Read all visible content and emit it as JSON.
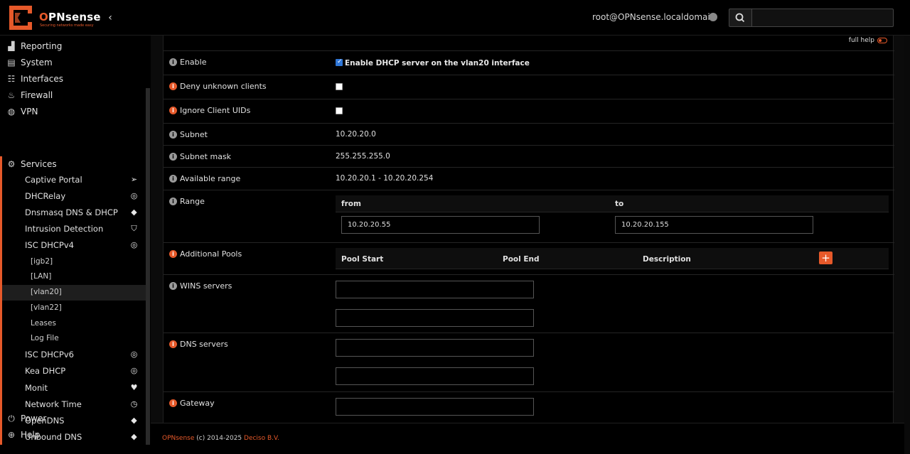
{
  "header": {
    "brand_prefix": "O",
    "brand_rest": "PNsense",
    "tagline": "Securing networks made easy",
    "user": "root@OPNsense.localdomain",
    "search_placeholder": ""
  },
  "sidebar": {
    "top": [
      {
        "label": "Reporting",
        "icon": "chart-icon"
      },
      {
        "label": "System",
        "icon": "server-icon"
      },
      {
        "label": "Interfaces",
        "icon": "sitemap-icon"
      },
      {
        "label": "Firewall",
        "icon": "fire-icon"
      },
      {
        "label": "VPN",
        "icon": "globe-icon"
      },
      {
        "label": "Services",
        "icon": "cog-icon"
      }
    ],
    "services": [
      {
        "label": "Captive Portal",
        "icon": "paper-plane-icon"
      },
      {
        "label": "DHCRelay",
        "icon": "bullseye-icon"
      },
      {
        "label": "Dnsmasq DNS & DHCP",
        "icon": "tags-icon"
      },
      {
        "label": "Intrusion Detection",
        "icon": "shield-icon"
      },
      {
        "label": "ISC DHCPv4",
        "icon": "bullseye-icon"
      }
    ],
    "dhcpv4_children": [
      "[igb2]",
      "[LAN]",
      "[vlan20]",
      "[vlan22]",
      "Leases",
      "Log File"
    ],
    "services_more": [
      {
        "label": "ISC DHCPv6",
        "icon": "bullseye-icon"
      },
      {
        "label": "Kea DHCP",
        "icon": "bullseye-icon"
      },
      {
        "label": "Monit",
        "icon": "heartbeat-icon"
      },
      {
        "label": "Network Time",
        "icon": "clock-icon"
      },
      {
        "label": "OpenDNS",
        "icon": "tags-icon"
      },
      {
        "label": "Unbound DNS",
        "icon": "tags-icon"
      }
    ],
    "bottom": [
      {
        "label": "Power",
        "icon": "plug-icon"
      },
      {
        "label": "Help",
        "icon": "lifebuoy-icon"
      }
    ]
  },
  "form": {
    "full_help": "full help",
    "enable_label": "Enable",
    "enable_text": "Enable DHCP server on the vlan20 interface",
    "deny_label": "Deny unknown clients",
    "ignore_label": "Ignore Client UIDs",
    "subnet_label": "Subnet",
    "subnet_value": "10.20.20.0",
    "mask_label": "Subnet mask",
    "mask_value": "255.255.255.0",
    "avail_label": "Available range",
    "avail_value": "10.20.20.1 - 10.20.20.254",
    "range_label": "Range",
    "range_from": "from",
    "range_to": "to",
    "range_from_value": "10.20.20.55",
    "range_to_value": "10.20.20.155",
    "pools_label": "Additional Pools",
    "pool_start": "Pool Start",
    "pool_end": "Pool End",
    "pool_desc": "Description",
    "wins_label": "WINS servers",
    "dns_label": "DNS servers",
    "gateway_label": "Gateway"
  },
  "footer": {
    "brand": "OPNsense",
    "text": " (c) 2014-2025 ",
    "company": "Deciso B.V."
  },
  "colors": {
    "accent": "#e6592a"
  }
}
